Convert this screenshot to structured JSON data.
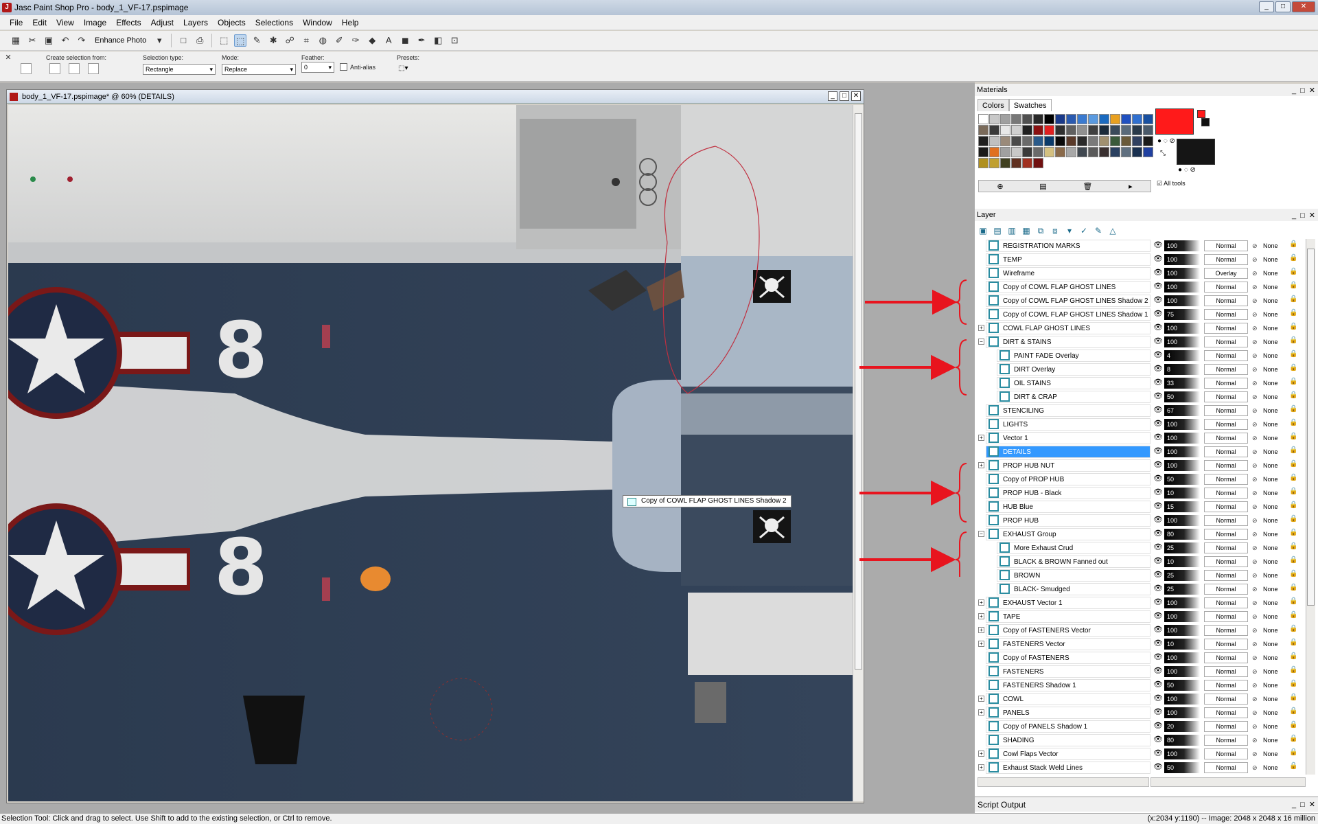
{
  "window": {
    "title": "Jasc Paint Shop Pro - body_1_VF-17.pspimage",
    "minimize": "_",
    "maximize": "□",
    "close": "✕"
  },
  "menu": [
    "File",
    "Edit",
    "View",
    "Image",
    "Effects",
    "Adjust",
    "Layers",
    "Objects",
    "Selections",
    "Window",
    "Help"
  ],
  "toolbar": {
    "enhance_photo": "Enhance Photo",
    "icons": [
      "browse-icon",
      "open-icon",
      "save-icon",
      "undo-icon",
      "redo-icon",
      "new-icon",
      "print-icon",
      "selection-tool-icon",
      "freehand-selection-icon",
      "eyedropper-icon",
      "clone-icon",
      "crop-icon",
      "paint-bucket-icon",
      "brush-icon",
      "eraser-icon",
      "text-icon",
      "shape-icon",
      "layer-icon",
      "pen-icon"
    ]
  },
  "tool_options": {
    "create_selection_from": "Create selection from:",
    "selection_type_label": "Selection type:",
    "selection_type_value": "Rectangle",
    "mode_label": "Mode:",
    "mode_value": "Replace",
    "feather_label": "Feather:",
    "feather_value": "0",
    "anti_alias_label": "Anti-alias",
    "presets_label": "Presets:"
  },
  "document": {
    "title": "body_1_VF-17.pspimage* @  60% (DETAILS)",
    "tooltip": "Copy of COWL FLAP GHOST LINES Shadow 2",
    "numerals": [
      "8",
      "8"
    ]
  },
  "materials": {
    "title": "Materials",
    "tabs": [
      "Colors",
      "Swatches"
    ],
    "active_tab": "Swatches",
    "all_tools_label": "All tools",
    "foreground_color": "#ff1a1a",
    "background_color": "#151515",
    "swatch_colors": [
      "#ffffff",
      "#c8c8c8",
      "#a0a0a0",
      "#787878",
      "#505050",
      "#282828",
      "#000000",
      "#1a3a8a",
      "#2a5ab0",
      "#3a7ad0",
      "#5a9ae0",
      "#1a6ac0",
      "#e8a020",
      "#2050c0",
      "#3070d0",
      "#1850a0",
      "#7a6a5a",
      "#3a3a3a",
      "#e8e8e8",
      "#d0d0d0",
      "#202020",
      "#8a1010",
      "#e02020",
      "#303030",
      "#606060",
      "#909090",
      "#404040",
      "#1a2a3a",
      "#3a4a5a",
      "#5a6a7a",
      "#2a3a4a",
      "#4a5a6a",
      "#202020",
      "#c0c0c0",
      "#9a8a7a",
      "#4a4a4a",
      "#6a6a6a",
      "#2a5a8a",
      "#0a3a6a",
      "#0a0a0a",
      "#5a3a2a",
      "#2a2a2a",
      "#7a7a7a",
      "#a09070",
      "#3a5a3a",
      "#6a5a3a",
      "#304060",
      "#1a1a1a",
      "#1a1a1a",
      "#e07020",
      "#a0a0a0",
      "#c8c8c8",
      "#3a3a3a",
      "#6a6a6a",
      "#d4c080",
      "#8a6a4a",
      "#a8a8a8",
      "#404850",
      "#5a5a5a",
      "#3a3030",
      "#2a4060",
      "#607080",
      "#1a3050",
      "#2040a0",
      "#b09020",
      "#c0a030",
      "#404020",
      "#603020",
      "#a03020",
      "#701010"
    ]
  },
  "layers": {
    "title": "Layer",
    "rows": [
      {
        "name": "REGISTRATION MARKS",
        "opacity": "100",
        "blend": "Normal",
        "mask": "None",
        "indent": 0,
        "expand": "",
        "selected": false
      },
      {
        "name": "TEMP",
        "opacity": "100",
        "blend": "Normal",
        "mask": "None",
        "indent": 0,
        "expand": "",
        "selected": false
      },
      {
        "name": "Wireframe",
        "opacity": "100",
        "blend": "Overlay",
        "mask": "None",
        "indent": 0,
        "expand": "",
        "selected": false
      },
      {
        "name": "Copy of COWL FLAP GHOST LINES",
        "opacity": "100",
        "blend": "Normal",
        "mask": "None",
        "indent": 0,
        "expand": "",
        "selected": false
      },
      {
        "name": "Copy of COWL FLAP GHOST LINES Shadow 2",
        "opacity": "100",
        "blend": "Normal",
        "mask": "None",
        "indent": 0,
        "expand": "",
        "selected": false
      },
      {
        "name": "Copy of COWL FLAP GHOST LINES Shadow 1",
        "opacity": "75",
        "blend": "Normal",
        "mask": "None",
        "indent": 0,
        "expand": "",
        "selected": false
      },
      {
        "name": "COWL FLAP GHOST LINES",
        "opacity": "100",
        "blend": "Normal",
        "mask": "None",
        "indent": 0,
        "expand": "+",
        "selected": false
      },
      {
        "name": "DIRT & STAINS",
        "opacity": "100",
        "blend": "Normal",
        "mask": "None",
        "indent": 0,
        "expand": "−",
        "selected": false
      },
      {
        "name": "PAINT FADE Overlay",
        "opacity": "4",
        "blend": "Normal",
        "mask": "None",
        "indent": 1,
        "expand": "",
        "selected": false
      },
      {
        "name": "DIRT Overlay",
        "opacity": "8",
        "blend": "Normal",
        "mask": "None",
        "indent": 1,
        "expand": "",
        "selected": false
      },
      {
        "name": "OIL STAINS",
        "opacity": "33",
        "blend": "Normal",
        "mask": "None",
        "indent": 1,
        "expand": "",
        "selected": false
      },
      {
        "name": "DIRT & CRAP",
        "opacity": "50",
        "blend": "Normal",
        "mask": "None",
        "indent": 1,
        "expand": "",
        "selected": false
      },
      {
        "name": "STENCILING",
        "opacity": "67",
        "blend": "Normal",
        "mask": "None",
        "indent": 0,
        "expand": "",
        "selected": false
      },
      {
        "name": "LIGHTS",
        "opacity": "100",
        "blend": "Normal",
        "mask": "None",
        "indent": 0,
        "expand": "",
        "selected": false
      },
      {
        "name": "Vector 1",
        "opacity": "100",
        "blend": "Normal",
        "mask": "None",
        "indent": 0,
        "expand": "+",
        "selected": false
      },
      {
        "name": "DETAILS",
        "opacity": "100",
        "blend": "Normal",
        "mask": "None",
        "indent": 0,
        "expand": "",
        "selected": true
      },
      {
        "name": "PROP HUB NUT",
        "opacity": "100",
        "blend": "Normal",
        "mask": "None",
        "indent": 0,
        "expand": "+",
        "selected": false
      },
      {
        "name": "Copy of PROP HUB",
        "opacity": "50",
        "blend": "Normal",
        "mask": "None",
        "indent": 0,
        "expand": "",
        "selected": false
      },
      {
        "name": "PROP HUB - Black",
        "opacity": "10",
        "blend": "Normal",
        "mask": "None",
        "indent": 0,
        "expand": "",
        "selected": false
      },
      {
        "name": "HUB Blue",
        "opacity": "15",
        "blend": "Normal",
        "mask": "None",
        "indent": 0,
        "expand": "",
        "selected": false
      },
      {
        "name": "PROP HUB",
        "opacity": "100",
        "blend": "Normal",
        "mask": "None",
        "indent": 0,
        "expand": "",
        "selected": false
      },
      {
        "name": "EXHAUST Group",
        "opacity": "80",
        "blend": "Normal",
        "mask": "None",
        "indent": 0,
        "expand": "−",
        "selected": false
      },
      {
        "name": "More Exhaust Crud",
        "opacity": "25",
        "blend": "Normal",
        "mask": "None",
        "indent": 1,
        "expand": "",
        "selected": false
      },
      {
        "name": "BLACK & BROWN Fanned out",
        "opacity": "10",
        "blend": "Normal",
        "mask": "None",
        "indent": 1,
        "expand": "",
        "selected": false
      },
      {
        "name": "BROWN",
        "opacity": "25",
        "blend": "Normal",
        "mask": "None",
        "indent": 1,
        "expand": "",
        "selected": false
      },
      {
        "name": "BLACK- Smudged",
        "opacity": "25",
        "blend": "Normal",
        "mask": "None",
        "indent": 1,
        "expand": "",
        "selected": false
      },
      {
        "name": "EXHAUST Vector 1",
        "opacity": "100",
        "blend": "Normal",
        "mask": "None",
        "indent": 0,
        "expand": "+",
        "selected": false
      },
      {
        "name": "TAPE",
        "opacity": "100",
        "blend": "Normal",
        "mask": "None",
        "indent": 0,
        "expand": "+",
        "selected": false
      },
      {
        "name": "Copy of FASTENERS Vector",
        "opacity": "100",
        "blend": "Normal",
        "mask": "None",
        "indent": 0,
        "expand": "+",
        "selected": false
      },
      {
        "name": "FASTENERS Vector",
        "opacity": "10",
        "blend": "Normal",
        "mask": "None",
        "indent": 0,
        "expand": "+",
        "selected": false
      },
      {
        "name": "Copy of FASTENERS",
        "opacity": "100",
        "blend": "Normal",
        "mask": "None",
        "indent": 0,
        "expand": "",
        "selected": false
      },
      {
        "name": "FASTENERS",
        "opacity": "100",
        "blend": "Normal",
        "mask": "None",
        "indent": 0,
        "expand": "",
        "selected": false
      },
      {
        "name": "FASTENERS Shadow 1",
        "opacity": "50",
        "blend": "Normal",
        "mask": "None",
        "indent": 0,
        "expand": "",
        "selected": false
      },
      {
        "name": "COWL",
        "opacity": "100",
        "blend": "Normal",
        "mask": "None",
        "indent": 0,
        "expand": "+",
        "selected": false
      },
      {
        "name": "PANELS",
        "opacity": "100",
        "blend": "Normal",
        "mask": "None",
        "indent": 0,
        "expand": "+",
        "selected": false
      },
      {
        "name": "Copy of PANELS Shadow 1",
        "opacity": "20",
        "blend": "Normal",
        "mask": "None",
        "indent": 0,
        "expand": "",
        "selected": false
      },
      {
        "name": "SHADING",
        "opacity": "80",
        "blend": "Normal",
        "mask": "None",
        "indent": 0,
        "expand": "",
        "selected": false
      },
      {
        "name": "Cowl Flaps Vector",
        "opacity": "100",
        "blend": "Normal",
        "mask": "None",
        "indent": 0,
        "expand": "+",
        "selected": false
      },
      {
        "name": "Exhaust Stack Weld Lines",
        "opacity": "50",
        "blend": "Normal",
        "mask": "None",
        "indent": 0,
        "expand": "+",
        "selected": false
      }
    ]
  },
  "script_output": {
    "title": "Script Output"
  },
  "status": {
    "message": "Selection Tool: Click and drag to select. Use Shift to add to the existing selection, or Ctrl to remove.",
    "info": "(x:2034 y:1190) -- Image:  2048 x 2048 x 16 million"
  }
}
